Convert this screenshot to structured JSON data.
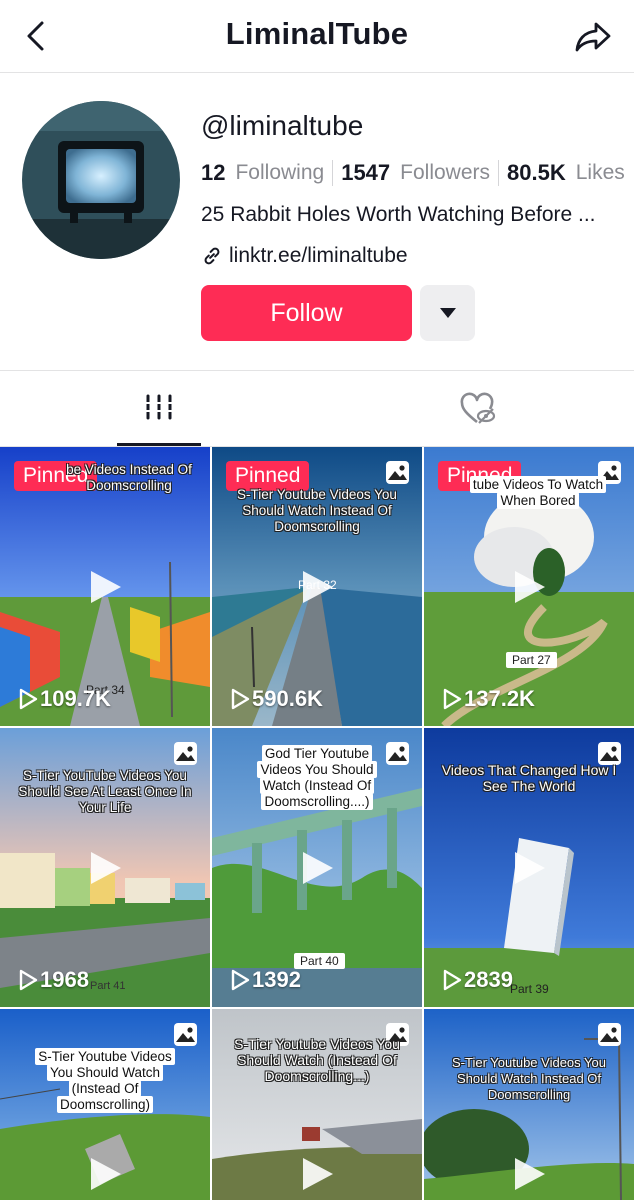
{
  "header": {
    "title": "LiminalTube",
    "back_icon": "chevron-left-icon",
    "share_icon": "share-arrow-icon"
  },
  "profile": {
    "handle": "@liminaltube",
    "following_count": "12",
    "following_label": "Following",
    "followers_count": "1547",
    "followers_label": "Followers",
    "likes_count": "80.5K",
    "likes_label": "Likes",
    "bio": "25 Rabbit Holes Worth Watching Before ...",
    "link": "linktr.ee/liminaltube",
    "follow_label": "Follow"
  },
  "tabs": [
    {
      "icon": "videos-grid-icon",
      "selected": true
    },
    {
      "icon": "liked-hidden-icon",
      "selected": false
    }
  ],
  "colors": {
    "accent": "#fe2c55",
    "text": "#161823",
    "muted": "#8a8b91"
  },
  "videos": [
    {
      "pinned": "Pinned",
      "caption": "be Videos Instead Of Doomscrolling",
      "views": "109.7K",
      "part": "Part 34"
    },
    {
      "pinned": "Pinned",
      "caption": "S-Tier Youtube Videos You Should Watch Instead Of Doomscrolling",
      "views": "590.6K",
      "part": "Part 32"
    },
    {
      "pinned": "Pinned",
      "caption": "tube Videos To Watch When Bored",
      "views": "137.2K",
      "part": "Part 27"
    },
    {
      "caption": "S-Tier YouTube Videos You Should See At Least Once In Your Life",
      "views": "1968",
      "part": "Part 41"
    },
    {
      "caption": "God Tier Youtube Videos You Should Watch (Instead Of Doomscrolling....)",
      "views": "1392",
      "part": "Part 40"
    },
    {
      "caption": "Videos That Changed How I See The World",
      "views": "2839",
      "part": "Part 39"
    },
    {
      "caption": "S-Tier Youtube Videos You Should Watch (Instead Of Doomscrolling)"
    },
    {
      "caption": "S-Tier Youtube Videos You Should Watch (Instead Of Doomscrolling...)"
    },
    {
      "caption": "S-Tier Youtube Videos You Should Watch Instead Of Doomscrolling"
    }
  ],
  "pinned_label": "Pinned"
}
